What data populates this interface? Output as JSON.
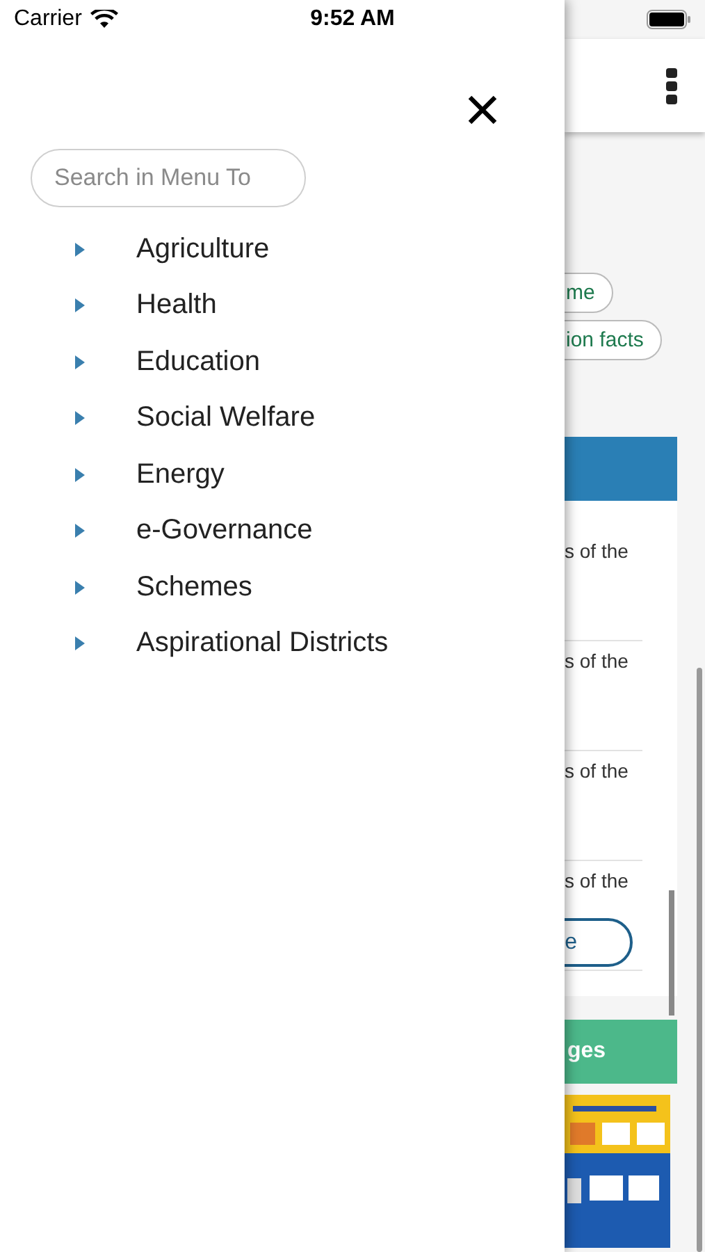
{
  "status_bar": {
    "carrier": "Carrier",
    "time": "9:52 AM"
  },
  "drawer": {
    "search": {
      "placeholder": "Search in Menu To"
    },
    "items": [
      {
        "label": "Agriculture",
        "expanded": false
      },
      {
        "label": "Health",
        "expanded": false
      },
      {
        "label": "Education",
        "expanded": false
      },
      {
        "label": "Social Welfare",
        "expanded": false
      },
      {
        "label": "Energy",
        "expanded": false
      },
      {
        "label": "e-Governance",
        "expanded": false
      },
      {
        "label": "Schemes",
        "expanded": false
      },
      {
        "label": "Aspirational Districts",
        "expanded": false
      }
    ]
  },
  "background_page": {
    "chips": [
      "me",
      "ion facts"
    ],
    "list_rows": [
      "s of the",
      "s of the",
      "s of the",
      "s of the"
    ],
    "button": "e",
    "section_header": "ges"
  }
}
